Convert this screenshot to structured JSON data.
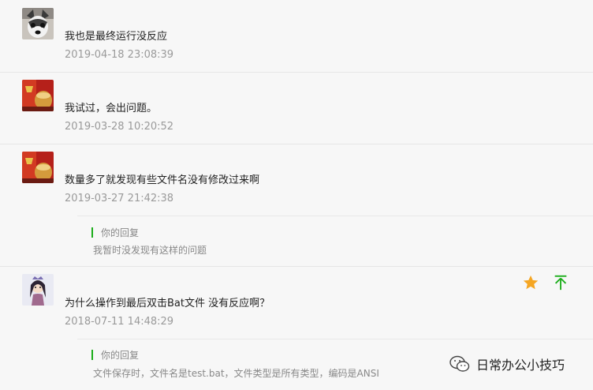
{
  "comments": [
    {
      "text": "我也是最终运行没反应",
      "date": "2019-04-18 23:08:39",
      "avatar": "husky-avatar"
    },
    {
      "text": "我试过，会出问题。",
      "date": "2019-03-28 10:20:52",
      "avatar": "tea-cup-avatar"
    },
    {
      "text": "数量多了就发现有些文件名没有修改过来啊",
      "date": "2019-03-27 21:42:38",
      "avatar": "tea-cup-avatar",
      "reply": {
        "title": "你的回复",
        "text": "我暂时没发现有这样的问题"
      }
    },
    {
      "text": "为什么操作到最后双击Bat文件 没有反应啊？",
      "date": "2018-07-11 14:48:29",
      "avatar": "cartoon-girl-avatar",
      "reply": {
        "title": "你的回复",
        "text": "文件保存时，文件名是test.bat，文件类型是所有类型，编码是ANSI"
      }
    }
  ],
  "actions": {
    "star_icon": "star-icon",
    "pin_icon": "pin-to-top-icon",
    "star_color": "#f5a623",
    "pin_color": "#1aad19"
  },
  "watermark": {
    "label": "日常办公小技巧",
    "icon": "wechat-icon"
  }
}
